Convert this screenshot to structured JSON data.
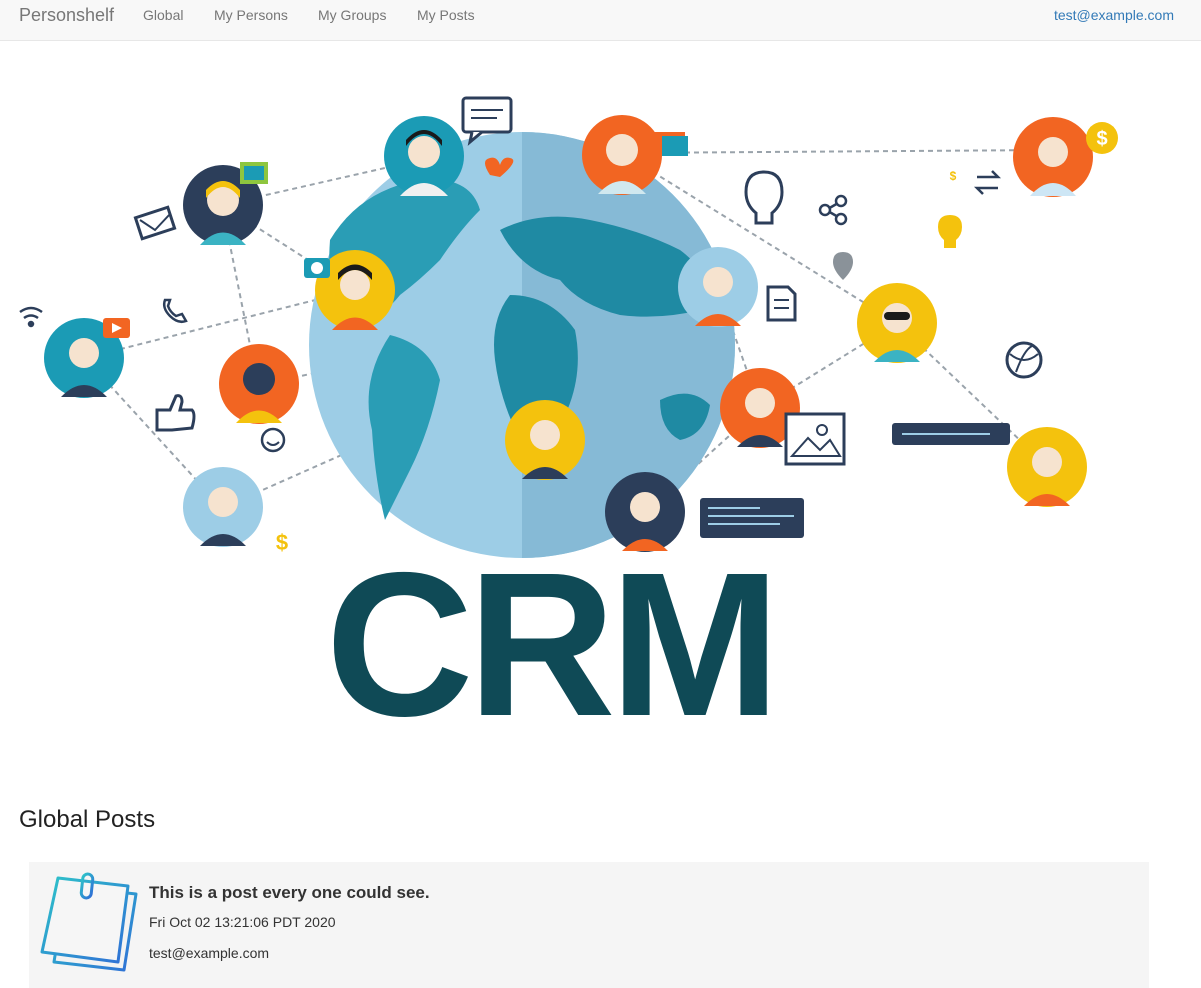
{
  "navbar": {
    "brand": "Personshelf",
    "links": [
      {
        "label": "Global"
      },
      {
        "label": "My Persons"
      },
      {
        "label": "My Groups"
      },
      {
        "label": "My Posts"
      }
    ],
    "user": "test@example.com"
  },
  "hero": {
    "text": "CRM",
    "icons": [
      "globe-icon",
      "person-avatar-icon",
      "chat-bubble-icon",
      "envelope-icon",
      "camera-icon",
      "lightbulb-icon",
      "share-icon",
      "map-pin-icon",
      "document-icon",
      "dollar-icon",
      "thumbs-up-icon",
      "smiley-icon",
      "wifi-icon",
      "video-play-icon",
      "phone-icon",
      "picture-icon",
      "heart-icon",
      "exchange-arrows-icon"
    ],
    "colors": {
      "ocean": "#9dcde6",
      "land": "#2a9db5",
      "dark_teal": "#0f4a56",
      "orange": "#f26522",
      "yellow": "#f4c20d",
      "navy": "#2c3e5a"
    }
  },
  "section": {
    "title": "Global Posts"
  },
  "posts": [
    {
      "title": "This is a post every one could see.",
      "date": "Fri Oct 02 13:21:06 PDT 2020",
      "author": "test@example.com",
      "icon": "sticky-note-icon"
    }
  ]
}
